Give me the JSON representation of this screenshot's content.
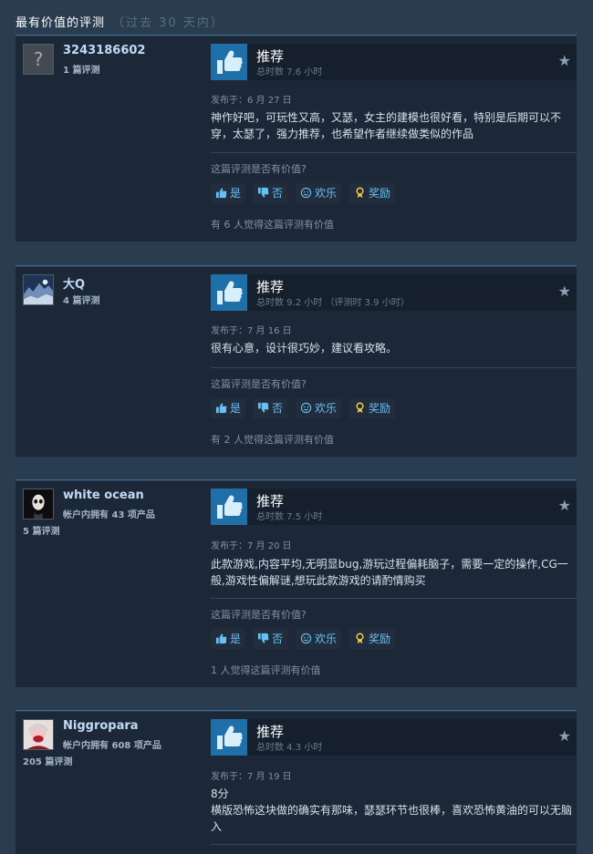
{
  "header": {
    "title": "最有价值的评测",
    "subtitle": "（过去 30 天内）"
  },
  "colors": {
    "background": "#2a3c50",
    "card": "#1c2838",
    "accent_blue": "#66c0f4",
    "thumb_bg": "#1f6fa8"
  },
  "labels": {
    "helpful_question": "这篇评测是否有价值?",
    "btn_yes": "是",
    "btn_no": "否",
    "btn_funny": "欢乐",
    "btn_award": "奖励"
  },
  "icons": {
    "recommend": "thumbs-up-icon",
    "award": "star-icon",
    "yes": "thumbs-up-small-icon",
    "no": "thumbs-down-small-icon",
    "funny": "smiley-icon",
    "reward": "ribbon-icon",
    "unknown_avatar": "question-mark-icon"
  },
  "reviews": [
    {
      "name": "3243186602",
      "meta1": "1 篇评测",
      "meta2": "",
      "vote": "推荐",
      "hours": "总时数 7.6 小时",
      "posted": "发布于：6 月 27 日",
      "content": "神作好吧，可玩性又高，又瑟，女主的建模也很好看，特别是后期可以不穿，太瑟了，强力推荐，也希望作者继续做类似的作品",
      "helpful": "有 6 人觉得这篇评测有价值"
    },
    {
      "name": "大Q",
      "meta1": "4 篇评测",
      "meta2": "",
      "vote": "推荐",
      "hours": "总时数 9.2 小时 （评测时 3.9 小时）",
      "posted": "发布于：7 月 16 日",
      "content": "很有心意，设计很巧妙，建议看攻略。",
      "helpful": "有 2 人觉得这篇评测有价值"
    },
    {
      "name": "white ocean",
      "meta1": "帐户内拥有 43 项产品",
      "meta2": "5 篇评测",
      "vote": "推荐",
      "hours": "总时数 7.5 小时",
      "posted": "发布于：7 月 20 日",
      "content": "此款游戏,内容平均,无明显bug,游玩过程偏耗脑子，需要一定的操作,CG一般,游戏性偏解谜,想玩此款游戏的请酌情购买",
      "helpful": "1 人觉得这篇评测有价值"
    },
    {
      "name": "Niggropara",
      "meta1": "帐户内拥有 608 项产品",
      "meta2": "205 篇评测",
      "vote": "推荐",
      "hours": "总时数 4.3 小时",
      "posted": "发布于：7 月 19 日",
      "content_lines": [
        "8分",
        "横版恐怖这块做的确实有那味，瑟瑟环节也很棒，喜欢恐怖黄油的可以无脑入"
      ]
    }
  ]
}
